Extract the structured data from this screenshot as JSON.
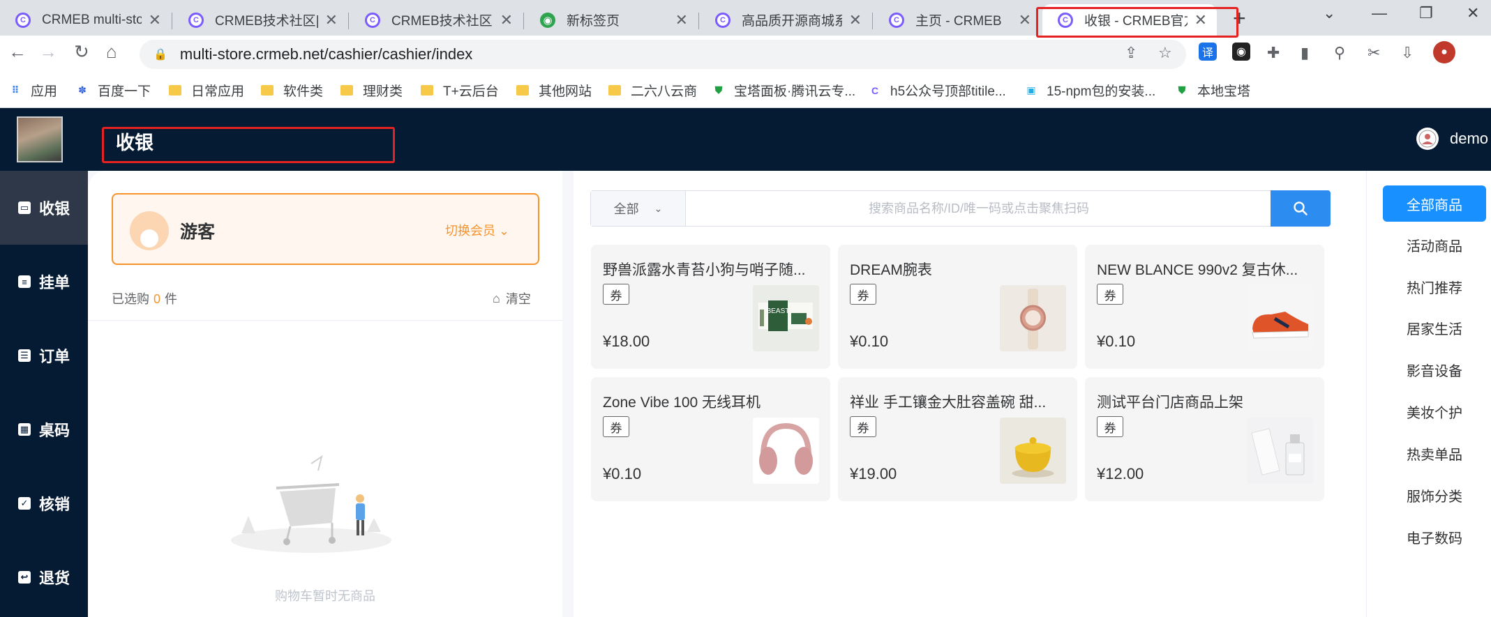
{
  "browser": {
    "tabs": [
      {
        "title": "CRMEB multi-stor",
        "icon": "crmeb-icon"
      },
      {
        "title": "CRMEB技术社区|多",
        "icon": "crmeb-icon"
      },
      {
        "title": "CRMEB技术社区|P",
        "icon": "crmeb-icon"
      },
      {
        "title": "新标签页",
        "icon": "wechat-icon"
      },
      {
        "title": "高品质开源商城系统",
        "icon": "crmeb-icon"
      },
      {
        "title": "主页 - CRMEB",
        "icon": "crmeb-icon"
      },
      {
        "title": "收银 - CRMEB官方",
        "icon": "crmeb-icon",
        "active": true
      }
    ],
    "tab_close": "✕",
    "new_tab": "+",
    "url": "multi-store.crmeb.net/cashier/cashier/index",
    "bookmarks": [
      {
        "label": "应用",
        "icon": "apps-grid-icon"
      },
      {
        "label": "百度一下",
        "icon": "baidu-paw-icon"
      },
      {
        "label": "日常应用",
        "icon": "folder-icon"
      },
      {
        "label": "软件类",
        "icon": "folder-icon"
      },
      {
        "label": "理财类",
        "icon": "folder-icon"
      },
      {
        "label": "T+云后台",
        "icon": "folder-icon"
      },
      {
        "label": "其他网站",
        "icon": "folder-icon"
      },
      {
        "label": "二六八云商",
        "icon": "folder-icon"
      },
      {
        "label": "宝塔面板·腾讯云专...",
        "icon": "baota-shield-icon"
      },
      {
        "label": "h5公众号顶部titile...",
        "icon": "crmeb-icon"
      },
      {
        "label": "15-npm包的安装...",
        "icon": "bilibili-icon"
      },
      {
        "label": "本地宝塔",
        "icon": "baota-shield-icon"
      }
    ]
  },
  "header": {
    "title": "收银",
    "user": "demo"
  },
  "sidebar": {
    "items": [
      {
        "label": "收银",
        "icon": "cashier-icon",
        "active": true
      },
      {
        "label": "挂单",
        "icon": "hang-order-icon"
      },
      {
        "label": "订单",
        "icon": "order-icon"
      },
      {
        "label": "桌码",
        "icon": "table-code-icon"
      },
      {
        "label": "核销",
        "icon": "verify-icon"
      },
      {
        "label": "退货",
        "icon": "return-icon"
      }
    ]
  },
  "cart": {
    "member_name": "游客",
    "switch_member": "切换会员",
    "selected_prefix": "已选购",
    "selected_count": "0",
    "selected_suffix": "件",
    "clear": "清空",
    "empty_text": "购物车暂时无商品"
  },
  "search": {
    "category": "全部",
    "placeholder": "搜索商品名称/ID/唯一码或点击聚焦扫码"
  },
  "goods": [
    {
      "name": "野兽派露水青苔小狗与哨子随...",
      "tag": "券",
      "price": "¥18.00",
      "image": "gift-set-image"
    },
    {
      "name": "DREAM腕表",
      "tag": "券",
      "price": "¥0.10",
      "image": "watch-image"
    },
    {
      "name": "NEW BLANCE 990v2 复古休...",
      "tag": "券",
      "price": "¥0.10",
      "image": "sneaker-image"
    },
    {
      "name": "Zone Vibe 100 无线耳机",
      "tag": "券",
      "price": "¥0.10",
      "image": "headphones-image"
    },
    {
      "name": "祥业 手工镶金大肚容盖碗 甜...",
      "tag": "券",
      "price": "¥19.00",
      "image": "tea-bowl-image"
    },
    {
      "name": "测试平台门店商品上架",
      "tag": "券",
      "price": "¥12.00",
      "image": "perfume-image"
    }
  ],
  "categories": {
    "active": "全部商品",
    "items": [
      "活动商品",
      "热门推荐",
      "居家生活",
      "影音设备",
      "美妆个护",
      "热卖单品",
      "服饰分类",
      "电子数码"
    ]
  },
  "colors": {
    "header_bg": "#051a33",
    "accent_orange": "#f8932b",
    "primary_blue": "#1890ff",
    "highlight_red": "#e52222"
  }
}
